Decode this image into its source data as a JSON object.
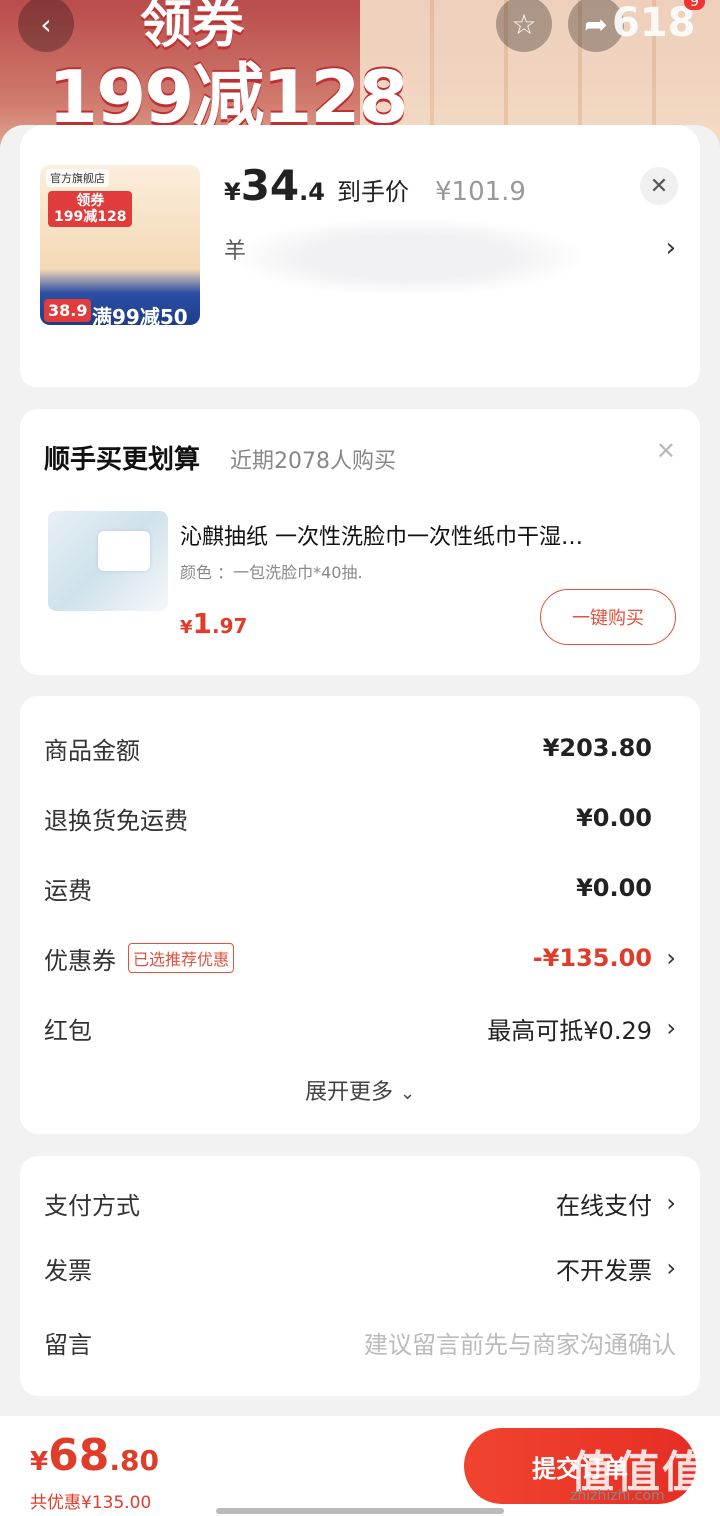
{
  "banner": {
    "promo_top": "领券",
    "promo_main": "199减128",
    "badge_618": "618",
    "badge_count": "9"
  },
  "product": {
    "shop_label": "官方旗舰店",
    "thumb_coupon": "领券\n199减128",
    "thumb_price": "38.9",
    "thumb_full_off": "满99减50",
    "price_currency": "¥",
    "price_int": "34",
    "price_dec": ".4",
    "price_label": "到手价",
    "orig_price": "¥101.9",
    "spec_text": "羊"
  },
  "recommend": {
    "title": "顺手买更划算",
    "subtitle": "近期2078人购买",
    "item_name": "沁麒抽纸  一次性洗脸巾一次性纸巾干湿…",
    "item_spec": "颜色 ：一包洗脸巾*40抽.",
    "price_currency": "¥",
    "price_int": "1",
    "price_dec": ".97",
    "buy_label": "一键购买"
  },
  "summary": {
    "goods_label": "商品金额",
    "goods_value": "¥203.80",
    "return_label": "退换货免运费",
    "return_value": "¥0.00",
    "shipping_label": "运费",
    "shipping_value": "¥0.00",
    "coupon_label": "优惠券",
    "coupon_tag": "已选推荐优惠",
    "coupon_value": "-¥135.00",
    "redpacket_label": "红包",
    "redpacket_value": "最高可抵¥0.29",
    "expand_label": "展开更多"
  },
  "payment": {
    "pay_label": "支付方式",
    "pay_value": "在线支付",
    "invoice_label": "发票",
    "invoice_value": "不开发票",
    "note_label": "留言",
    "note_placeholder": "建议留言前先与商家沟通确认"
  },
  "footer": {
    "total_currency": "¥",
    "total_int": "68",
    "total_dec": ".80",
    "saving": "共优惠¥135.00",
    "submit_label": "提交订单",
    "watermark": "值值值",
    "watermark_url": "zhizhizhi.com"
  },
  "colors": {
    "accent": "#e03c2a",
    "background": "#f2f2f2"
  }
}
